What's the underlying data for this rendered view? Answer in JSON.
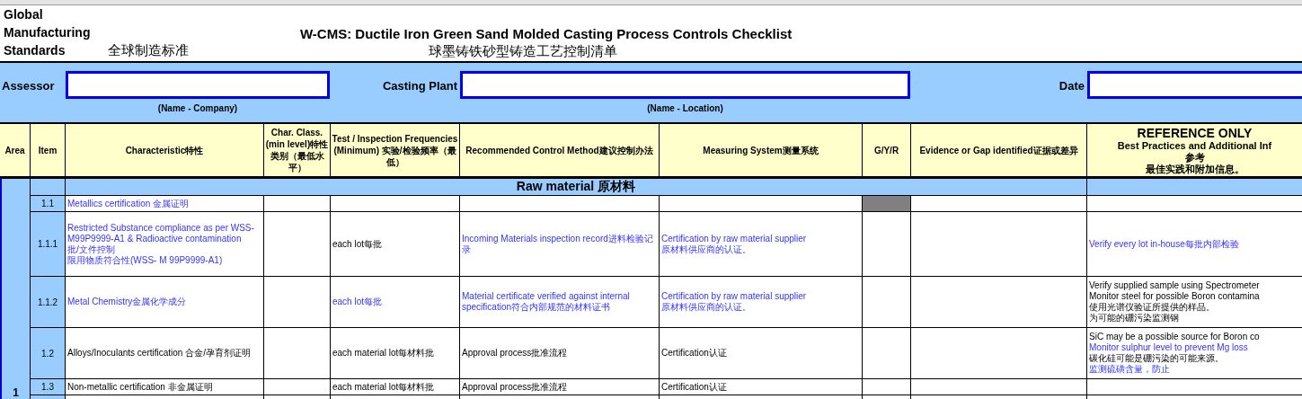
{
  "org_name": "Global Manufacturing Standards",
  "org_name_zh": "全球制造标准",
  "title": "W-CMS:  Ductile Iron Green Sand Molded Casting Process Controls Checklist",
  "title_zh": "球墨铸铁砂型铸造工艺控制清单",
  "fields": [
    {
      "label": "Assessor",
      "hint": "(Name - Company)"
    },
    {
      "label": "Casting Plant",
      "hint": "(Name - Location)"
    },
    {
      "label": "Date"
    }
  ],
  "columns": [
    "Area",
    "Item",
    "Characteristic特性",
    "Char. Class. (min level)特性类别（最低水平）",
    "Test / Inspection Frequencies (Minimum) 实验/检验频率（最低）",
    "Recommended Control Method建议控制办法",
    "Measuring System测量系统",
    "G/Y/R",
    "Evidence or Gap identified证据或差异"
  ],
  "reference_header": {
    "title": "REFERENCE ONLY",
    "lines": [
      "Best Practices and Additional Inf",
      "参考",
      "最佳实践和附加信息。"
    ]
  },
  "section": {
    "title": "Raw material 原材料",
    "area": "1"
  },
  "rows": [
    {
      "item": "1.1",
      "characteristic": [
        {
          "text": "Metallics certification 金属证明",
          "highlight": true
        }
      ],
      "gyr": {
        "color": "#808080"
      }
    },
    {
      "item": "1.1.1",
      "characteristic": [
        {
          "text": "Restricted Substance compliance as per WSS-M99P9999-A1 & Radioactive contamination",
          "highlight": true
        },
        {
          "text": "批/文件控制",
          "highlight": true
        },
        {
          "text": "限用物质符合性(WSS- M 99P9999-A1)",
          "highlight": true
        }
      ],
      "frequency": [
        {
          "text": "each lot每批",
          "highlight": false
        }
      ],
      "control_method": [
        {
          "text": "Incoming Materials inspection record进料检验记录",
          "highlight": true
        }
      ],
      "measuring_system": [
        {
          "text": "Certification by raw material supplier",
          "highlight": true
        },
        {
          "text": "原材料供应商的认证。",
          "highlight": true
        }
      ],
      "reference": [
        {
          "text": "Verify every lot in-house每批内部检验",
          "highlight": true
        }
      ]
    },
    {
      "item": "1.1.2",
      "characteristic": [
        {
          "text": "Metal Chemistry金属化学成分",
          "highlight": true
        }
      ],
      "frequency": [
        {
          "text": "each lot每批",
          "highlight": true
        }
      ],
      "control_method": [
        {
          "text": "Material certificate verified against internal specification符合内部规范的材料证书",
          "highlight": true
        }
      ],
      "measuring_system": [
        {
          "text": "Certification by raw material supplier",
          "highlight": true
        },
        {
          "text": "原材料供应商的认证。",
          "highlight": true
        }
      ],
      "reference": [
        {
          "text": "Verify supplied sample using Spectrometer",
          "highlight": false
        },
        {
          "text": "Monitor steel for possible Boron contamina",
          "highlight": false
        },
        {
          "text": "使用光谱仪验证所提供的样品。",
          "highlight": false
        },
        {
          "text": "为可能的硼污染监测钢",
          "highlight": false
        }
      ]
    },
    {
      "item": "1.2",
      "characteristic": [
        {
          "text": "Alloys/Inoculants certification 合金/孕育剂证明",
          "highlight": false
        }
      ],
      "frequency": [
        {
          "text": "each material lot每材料批",
          "highlight": false
        }
      ],
      "control_method": [
        {
          "text": "Approval process批准流程",
          "highlight": false
        }
      ],
      "measuring_system": [
        {
          "text": "Certification认证",
          "highlight": false
        }
      ],
      "reference": [
        {
          "text": "SiC may be a possible source for Boron co",
          "highlight": false
        },
        {
          "text": "Monitor sulphur level to prevent Mg loss",
          "highlight": true
        },
        {
          "text": "碳化硅可能是硼污染的可能来源。",
          "highlight": false
        },
        {
          "text": "监测硫磺含量，防止",
          "highlight": true
        }
      ]
    },
    {
      "item": "1.3",
      "characteristic": [
        {
          "text": "Non-metallic certification 非金属证明",
          "highlight": false
        }
      ],
      "frequency": [
        {
          "text": "each material lot每材料批",
          "highlight": false
        }
      ],
      "control_method": [
        {
          "text": "Approval process批准流程",
          "highlight": false
        }
      ],
      "measuring_system": [
        {
          "text": "Certification认证",
          "highlight": false
        }
      ]
    }
  ]
}
